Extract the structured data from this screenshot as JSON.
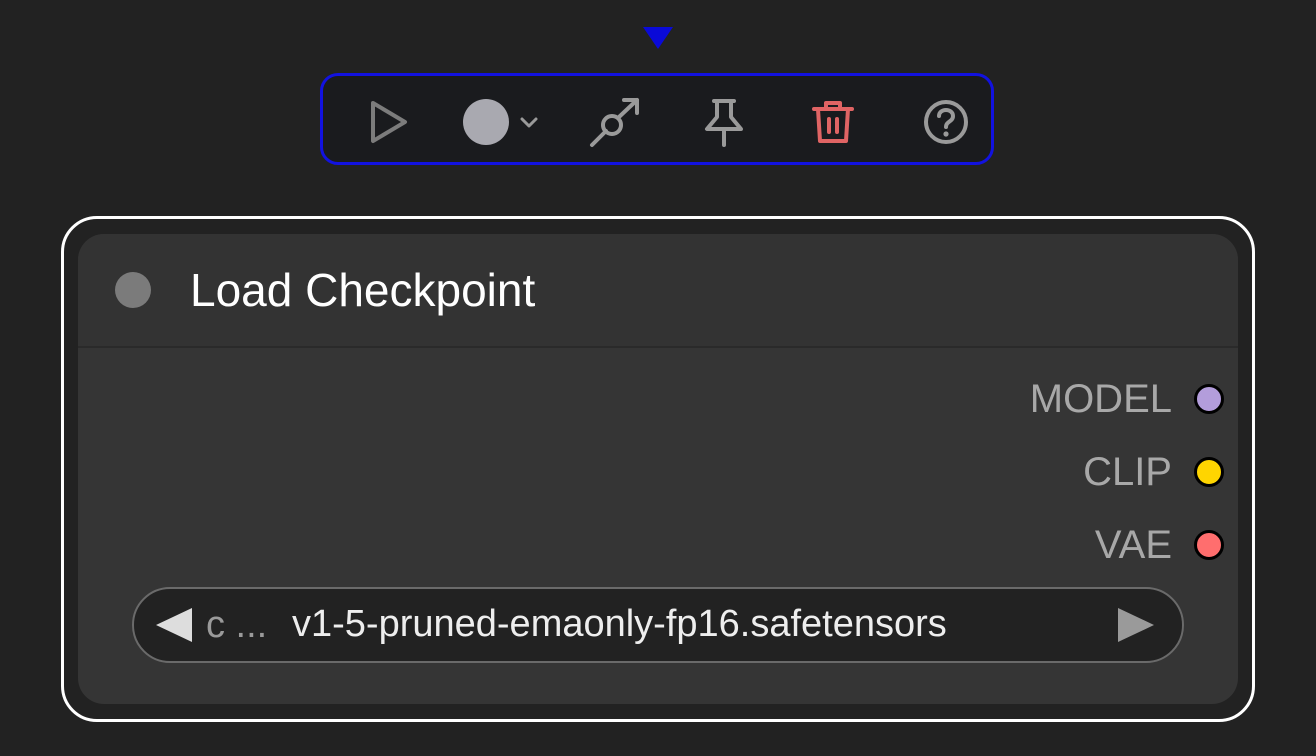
{
  "toolbar": {
    "buttons": [
      {
        "name": "run",
        "icon": "play-icon"
      },
      {
        "name": "color",
        "icon": "color-circle-icon",
        "dropdown_icon": "chevron-down-icon"
      },
      {
        "name": "bypass",
        "icon": "bypass-icon"
      },
      {
        "name": "pin",
        "icon": "pin-icon"
      },
      {
        "name": "delete",
        "icon": "trash-icon"
      },
      {
        "name": "help",
        "icon": "help-circle-icon"
      }
    ],
    "colors": {
      "border": "#1212e0",
      "icon": "#7c7c7c",
      "delete": "#e06464",
      "color_swatch": "#a9a9b0"
    }
  },
  "node": {
    "title": "Load Checkpoint",
    "outputs": [
      {
        "label": "MODEL",
        "color": "#b39ddb"
      },
      {
        "label": "CLIP",
        "color": "#ffd500"
      },
      {
        "label": "VAE",
        "color": "#ff6e6e"
      }
    ],
    "widget": {
      "name": "c ...",
      "value": "v1-5-pruned-emaonly-fp16.safetensors"
    }
  }
}
